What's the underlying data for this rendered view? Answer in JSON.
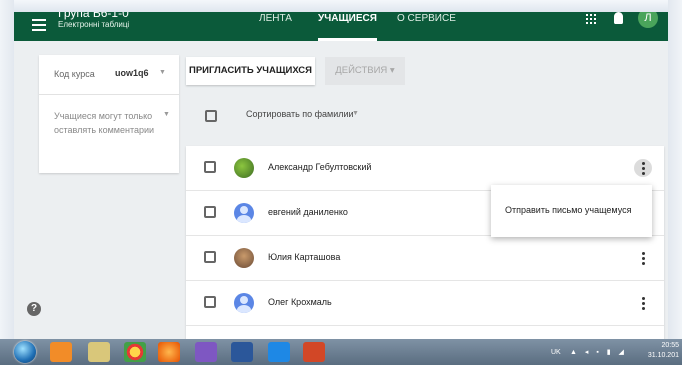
{
  "topbar": {
    "course_title": "Група Б6-1-0",
    "course_subtitle": "Електронні таблиці",
    "tabs": [
      {
        "label": "ЛЕНТА"
      },
      {
        "label": "УЧАЩИЕСЯ"
      },
      {
        "label": "О СЕРВИСЕ"
      }
    ],
    "avatar_letter": "Л"
  },
  "info_card": {
    "code_label": "Код курса",
    "code_value": "uow1q6",
    "permission_text": "Учащиеся могут только оставлять комментарии"
  },
  "toolbar": {
    "invite_label": "ПРИГЛАСИТЬ УЧАЩИХСЯ",
    "actions_label": "ДЕЙСТВИЯ ▾"
  },
  "sort": {
    "label": "Сортировать по фамилии"
  },
  "students": [
    {
      "name": "Александр Гебултовский"
    },
    {
      "name": "евгений даниленко"
    },
    {
      "name": "Юлия Карташова"
    },
    {
      "name": "Олег Крохмаль"
    }
  ],
  "context_menu": {
    "item": "Отправить письмо учащемуся"
  },
  "taskbar": {
    "language": "UK",
    "time": "20:55",
    "date": "31.10.201"
  },
  "colors": {
    "header_green": "#0b5a3a",
    "avatar_blue": "#5b86e5"
  }
}
